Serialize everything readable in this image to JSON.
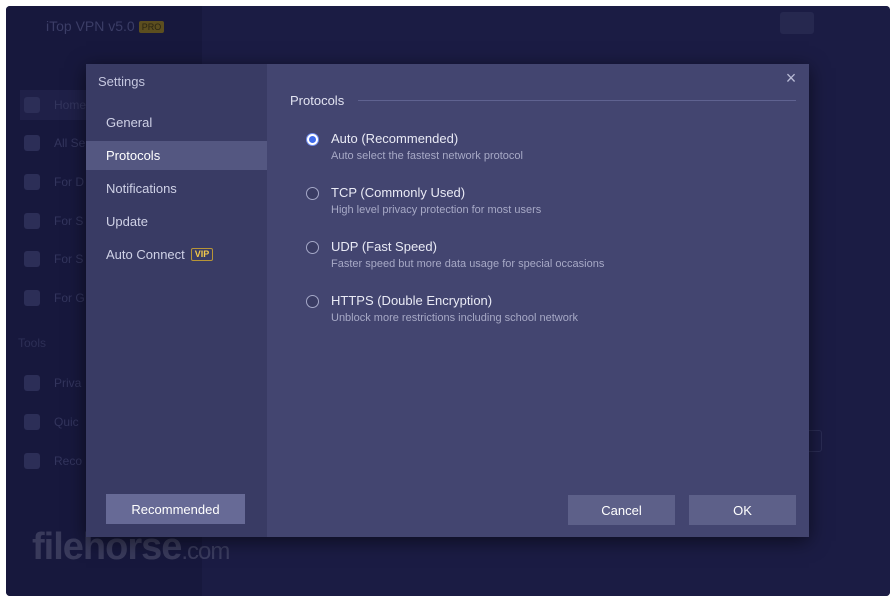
{
  "background_app": {
    "title": "iTop VPN v5.0",
    "badge": "PRO",
    "nav": [
      "Home",
      "All Se",
      "For D",
      "For S",
      "For S",
      "For G"
    ],
    "tools_label": "Tools",
    "tools": [
      "Priva",
      "Quic",
      "Reco"
    ]
  },
  "dialog": {
    "title": "Settings",
    "close_icon": "×",
    "sidebar": {
      "items": [
        {
          "label": "General"
        },
        {
          "label": "Protocols"
        },
        {
          "label": "Notifications"
        },
        {
          "label": "Update"
        },
        {
          "label": "Auto Connect",
          "badge": "VIP"
        }
      ],
      "active": "Protocols",
      "recommended_label": "Recommended"
    },
    "section_title": "Protocols",
    "options": [
      {
        "label": "Auto (Recommended)",
        "desc": "Auto select the fastest network protocol",
        "checked": true
      },
      {
        "label": "TCP (Commonly Used)",
        "desc": "High level privacy protection for most users",
        "checked": false
      },
      {
        "label": "UDP (Fast Speed)",
        "desc": "Faster speed but more data usage for special occasions",
        "checked": false
      },
      {
        "label": "HTTPS (Double Encryption)",
        "desc": "Unblock more restrictions including school network",
        "checked": false
      }
    ],
    "buttons": {
      "cancel": "Cancel",
      "ok": "OK"
    }
  },
  "watermark": {
    "brand": "filehorse",
    "tld": ".com"
  },
  "colors": {
    "accent": "#3f6bea",
    "vip": "#f3c94a",
    "dialog_bg": "#434570",
    "sidebar_bg": "#393b64"
  }
}
